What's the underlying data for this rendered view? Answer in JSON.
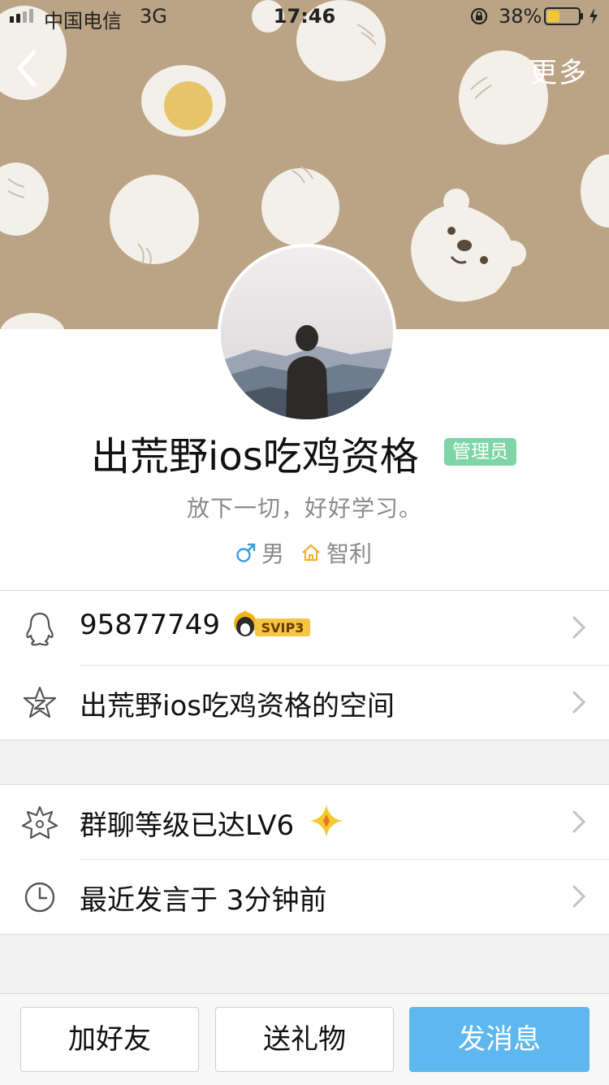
{
  "status_bar": {
    "carrier": "中国电信",
    "network": "3G",
    "time": "17:46",
    "battery_percent": "38%"
  },
  "nav": {
    "back_icon": "chevron-left-icon",
    "more_label": "更多"
  },
  "profile": {
    "name": "出荒野ios吃鸡资格",
    "role_badge": "管理员",
    "signature": "放下一切，好好学习。",
    "gender": "男",
    "location": "智利"
  },
  "info_section": {
    "items": [
      {
        "icon": "qq-penguin-icon",
        "label": "95877749",
        "badge": "SVIP3"
      },
      {
        "icon": "qzone-star-icon",
        "label": "出荒野ios吃鸡资格的空间"
      }
    ]
  },
  "group_section": {
    "items": [
      {
        "icon": "star-outline-icon",
        "label": "群聊等级已达LV6"
      },
      {
        "icon": "clock-icon",
        "label": "最近发言于 3分钟前"
      }
    ]
  },
  "actions": {
    "add_friend": "加好友",
    "send_gift": "送礼物",
    "send_message": "发消息"
  },
  "colors": {
    "header_bg": "#bba485",
    "admin_badge": "#7ed6a6",
    "primary_button": "#5fb7ef",
    "gender_male": "#3d9bd8",
    "location_icon": "#f0b030"
  }
}
